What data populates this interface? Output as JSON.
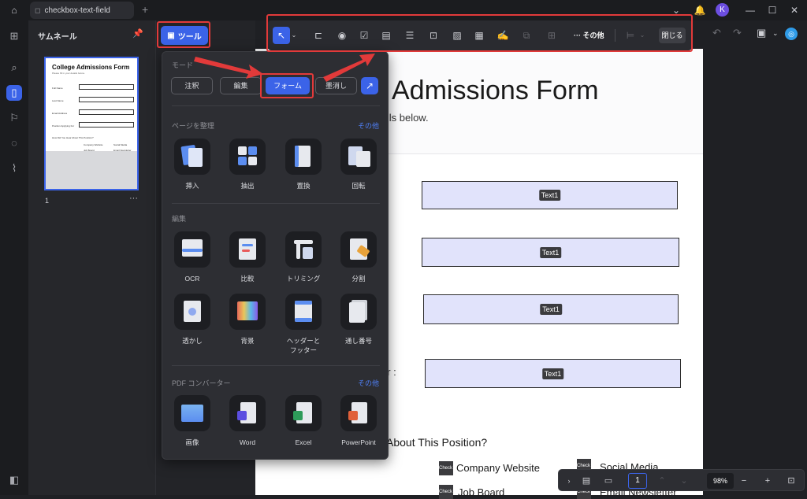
{
  "titlebar": {
    "tab_title": "checkbox-text-field"
  },
  "user": {
    "avatar_initial": "K"
  },
  "thumbnails": {
    "title": "サムネール",
    "page_number": "1",
    "preview": {
      "title": "College Admissions Form",
      "subtitle": "Please fill in your details below.",
      "rows": [
        "Full Name",
        "Last Name",
        "Email Address",
        "Position Applying For"
      ],
      "question": "How Did You Hear About This Position?",
      "options": [
        "Company Website",
        "Social Media",
        "Job Board",
        "Email Newsletter",
        "Referral from a Friend or Employee"
      ]
    }
  },
  "tools_button": {
    "label": "ツール"
  },
  "toolbar": {
    "more_label": "その他",
    "close_label": "閉じる"
  },
  "popup": {
    "mode_label": "モード",
    "modes": [
      "注釈",
      "編集",
      "フォーム",
      "墨消し"
    ],
    "organize": {
      "label": "ページを整理",
      "more": "その他",
      "items": [
        "挿入",
        "抽出",
        "置換",
        "回転"
      ]
    },
    "edit": {
      "label": "編集",
      "items": [
        "OCR",
        "比較",
        "トリミング",
        "分割",
        "透かし",
        "背景",
        "ヘッダーと\nフッター",
        "通し番号"
      ]
    },
    "convert": {
      "label": "PDF コンバーター",
      "more": "その他",
      "items": [
        "画像",
        "Word",
        "Excel",
        "PowerPoint"
      ]
    }
  },
  "document": {
    "title": "Admissions Form",
    "subtitle": "tails below.",
    "fields": [
      "Text1",
      "Text1",
      "Text1",
      "Text1"
    ],
    "label_fragment": "or :",
    "question": "About This Position?",
    "checkbox_tag": "Check Box",
    "options": [
      "Company Website",
      "Social Media",
      "Job Board",
      "Email Newsletter"
    ]
  },
  "status": {
    "page": "1",
    "zoom": "98%"
  },
  "colors": {
    "accent": "#3b63e8",
    "highlight": "#e23a3a",
    "field": "#e1e3fb"
  }
}
